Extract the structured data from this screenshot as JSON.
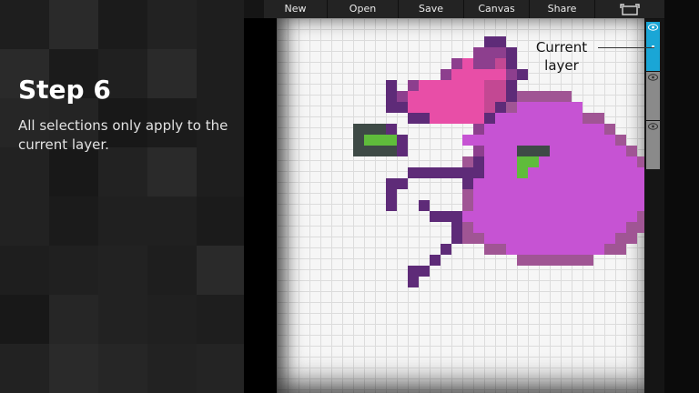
{
  "toolbar": {
    "items": [
      "New",
      "Open",
      "Save",
      "Canvas",
      "Share"
    ],
    "last_icon": "fullscreen-toggle-icon"
  },
  "tutorial": {
    "title": "Step 6",
    "description": "All selections only apply to the current layer."
  },
  "layers_panel": {
    "current_label": "Current layer",
    "count": 3,
    "current_index": 0,
    "current_color": "#1aa6d6",
    "other_color": "#8a8a8a"
  },
  "artwork": {
    "palette": {
      "D": "#5e2b78",
      "P": "#8d3f8e",
      "K": "#e84ea7",
      "M": "#c34893",
      "R": "#a05594",
      "L": "#c653d3",
      "G": "#5fbc3b",
      "C": "#3e4a46"
    },
    "rows": [
      "...............DD......",
      "..............PPPD.....",
      "............PKPPMD.....",
      "...........PKKKKKPD....",
      "......D.PKKKKKKMMD.....",
      "......DPKKKKKKKMMDRRRRR",
      "......DDKKKKKKKMDRLLLLLL",
      "........DDKKKKKDLLLLLLLLRR",
      "...CCCD.......PLLLLLLLLLLLR",
      "...CGGGD.....LLLLLLLLLLLLLLR",
      "...CCCCD......PLLLCCCLLLLLLLR",
      ".............RDLLLGGLLLLLLLLLR",
      "........DDDDDDDLLLGLLLLLLLLLLLR",
      "......DD.....DLLLLLLLLLLLLLLLLR",
      "......D......RLLLLLLLLLLLLLLLLR",
      "......D..D...RLLLLLLLLLLLLLLLLR",
      "..........DDDLLLLLLLLLLLLLLLLR",
      "............DRLLLLLLLLLLLLLLRR",
      "............DRRLLLLLLLLLLLLRR",
      "...........D...RRLLLLLLLLLRR",
      "..........D.......RRRRRRR",
      "........DD",
      "........D"
    ]
  }
}
